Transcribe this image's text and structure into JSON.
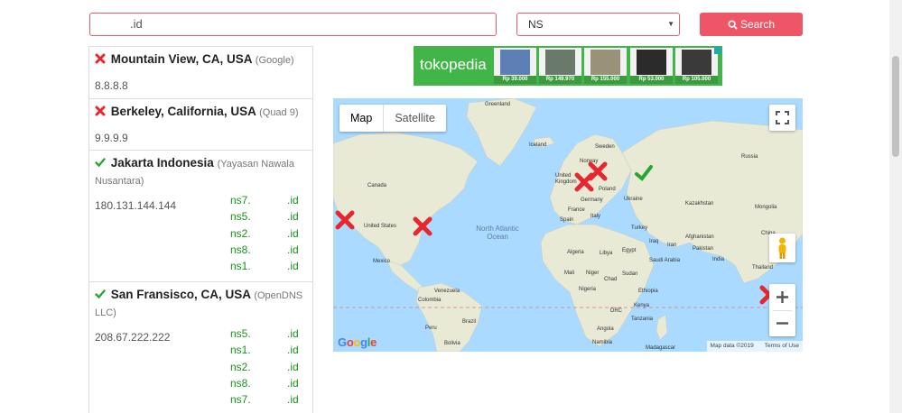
{
  "search": {
    "query": "          .id",
    "record_type": "NS",
    "button_label": "Search"
  },
  "results": [
    {
      "status": "fail",
      "location": "Mountain View, CA, USA",
      "provider": "(Google)",
      "ip": "8.8.8.8",
      "ns": []
    },
    {
      "status": "fail",
      "location": "Berkeley, California, USA",
      "provider": "(Quad 9)",
      "ip": "9.9.9.9",
      "ns": []
    },
    {
      "status": "ok",
      "location": "Jakarta Indonesia",
      "provider": "(Yayasan Nawala Nusantara)",
      "ip": "180.131.144.144",
      "ns": [
        {
          "host": "ns7.",
          "domain": ".id"
        },
        {
          "host": "ns5.",
          "domain": ".id"
        },
        {
          "host": "ns2.",
          "domain": ".id"
        },
        {
          "host": "ns8.",
          "domain": ".id"
        },
        {
          "host": "ns1.",
          "domain": ".id"
        }
      ]
    },
    {
      "status": "ok",
      "location": "San Fransisco, CA, USA",
      "provider": "(OpenDNS LLC)",
      "ip": "208.67.222.222",
      "ns": [
        {
          "host": "ns5.",
          "domain": ".id"
        },
        {
          "host": "ns1.",
          "domain": ".id"
        },
        {
          "host": "ns2.",
          "domain": ".id"
        },
        {
          "host": "ns8.",
          "domain": ".id"
        },
        {
          "host": "ns7.",
          "domain": ".id"
        }
      ]
    }
  ],
  "ad": {
    "brand": "tokopedia",
    "products": [
      {
        "price": "Rp 39.000",
        "color": "#5d7fb5"
      },
      {
        "price": "Rp 149.970",
        "color": "#6a7a6a"
      },
      {
        "price": "Rp 155.000",
        "color": "#9a9278"
      },
      {
        "price": "Rp 53.000",
        "color": "#2b2b2b"
      },
      {
        "price": "Rp 105.000",
        "color": "#3a3a3a"
      }
    ]
  },
  "map": {
    "map_type_tabs": [
      "Map",
      "Satellite"
    ],
    "active_tab": "Map",
    "attribution": "Map data ©2019",
    "terms": "Terms of Use",
    "logo": "Google",
    "labels": {
      "greenland": "Greenland",
      "iceland": "Iceland",
      "sweden": "Sweden",
      "russia": "Russia",
      "norway": "Norway",
      "uk": "United Kingdom",
      "poland": "Poland",
      "germany": "Germany",
      "ukraine": "Ukraine",
      "france": "France",
      "italy": "Italy",
      "spain": "Spain",
      "kazakhstan": "Kazakhstan",
      "mongolia": "Mongolia",
      "turkey": "Turkey",
      "iraq": "Iraq",
      "iran": "Iran",
      "afghanistan": "Afghanistan",
      "pakistan": "Pakistan",
      "china": "China",
      "india": "India",
      "thailand": "Thailand",
      "saudi": "Saudi Arabia",
      "egypt": "Egypt",
      "libya": "Libya",
      "algeria": "Algeria",
      "mali": "Mali",
      "niger": "Niger",
      "chad": "Chad",
      "sudan": "Sudan",
      "nigeria": "Nigeria",
      "ethiopia": "Ethiopia",
      "drc": "DRC",
      "kenya": "Kenya",
      "tanzania": "Tanzania",
      "angola": "Angola",
      "namibia": "Namibia",
      "madagascar": "Madagascar",
      "canada": "Canada",
      "usa": "United States",
      "mexico": "Mexico",
      "venezuela": "Venezuela",
      "colombia": "Colombia",
      "peru": "Peru",
      "brazil": "Brazil",
      "bolivia": "Bolivia",
      "atlantic": "North Atlantic Ocean"
    },
    "marker_colors": {
      "fail": "#e8262e",
      "ok": "#27a630"
    }
  },
  "colors": {
    "accent": "#ee5566",
    "ns_green": "#18941c",
    "ocean": "#aadaff",
    "land": "#e8ead6"
  },
  "icons": {
    "search": "search-icon",
    "fail": "x-icon",
    "ok": "check-icon",
    "fullscreen": "fullscreen-icon",
    "pegman": "pegman-icon",
    "zoom_in": "plus-icon",
    "zoom_out": "minus-icon"
  }
}
